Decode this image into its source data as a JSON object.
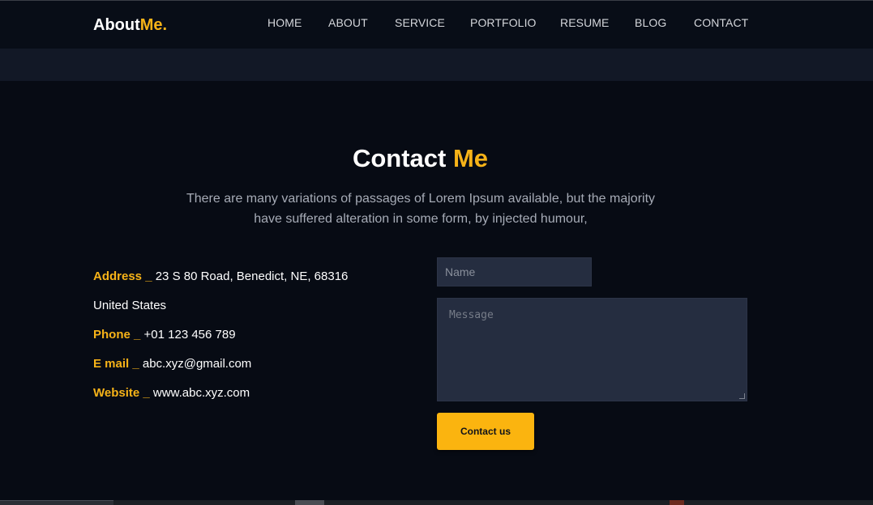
{
  "header": {
    "logo_main": "About",
    "logo_accent": "Me.",
    "nav": [
      "HOME",
      "ABOUT",
      "SERVICE",
      "PORTFOLIO",
      "RESUME",
      "BLOG",
      "CONTACT"
    ]
  },
  "contact": {
    "title_main": "Contact",
    "title_accent": "Me",
    "subtitle_line1": "There are many variations of passages of Lorem Ipsum available, but the majority",
    "subtitle_line2": "have suffered alteration in some form, by injected humour,",
    "info": {
      "address_label": "Address _",
      "address_value": " 23 S 80 Road, Benedict, NE, 68316",
      "country": "United States",
      "phone_label": "Phone _",
      "phone_value": " +01 123 456 789",
      "email_label": "E mail _",
      "email_value": " abc.xyz@gmail.com",
      "website_label": "Website _",
      "website_value": " www.abc.xyz.com"
    },
    "form": {
      "name_placeholder": "Name",
      "message_placeholder": "Message",
      "submit_label": "Contact us"
    }
  },
  "colors": {
    "background": "#070b14",
    "accent": "#f7b318",
    "input_bg": "#252d40",
    "button": "#fbb40f"
  }
}
